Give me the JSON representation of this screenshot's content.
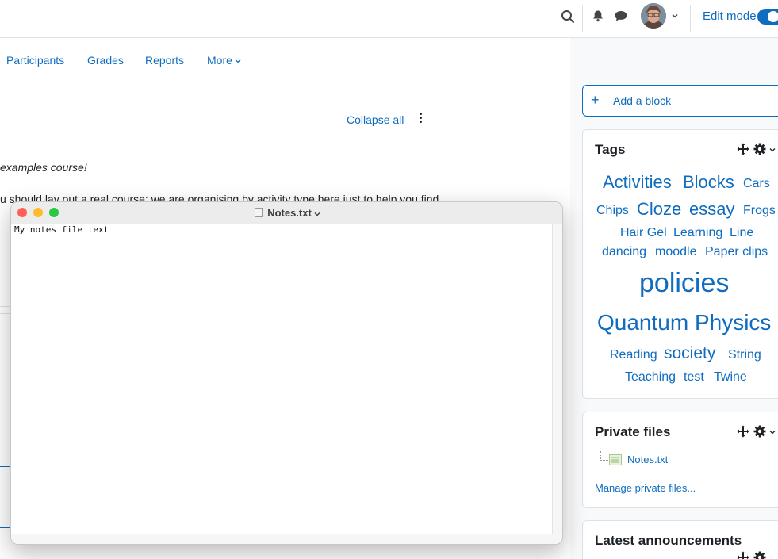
{
  "header": {
    "edit_mode_label": "Edit mode",
    "edit_mode_on": true,
    "icons": [
      "search-icon",
      "bell-icon",
      "chat-icon",
      "chevron-down-icon"
    ]
  },
  "secondary_nav": {
    "tabs": [
      {
        "label": "Participants"
      },
      {
        "label": "Grades"
      },
      {
        "label": "Reports"
      },
      {
        "label": "More"
      }
    ]
  },
  "course": {
    "collapse_all": "Collapse all",
    "welcome_fragment": "examples course!",
    "intro_fragment": "u should lay out a real course; we are organising by activity type here just to help you find"
  },
  "drawer": {
    "add_block_label": "Add a block",
    "tags": {
      "title": "Tags",
      "items": [
        {
          "label": "Activities"
        },
        {
          "label": "Blocks"
        },
        {
          "label": "Cars"
        },
        {
          "label": "Chips"
        },
        {
          "label": "Cloze"
        },
        {
          "label": "essay"
        },
        {
          "label": "Frogs"
        },
        {
          "label": "Hair Gel"
        },
        {
          "label": "Learning"
        },
        {
          "label": "Line dancing"
        },
        {
          "label": "moodle"
        },
        {
          "label": "Paper clips"
        },
        {
          "label": "policies"
        },
        {
          "label": "Quantum Physics"
        },
        {
          "label": "Reading"
        },
        {
          "label": "society"
        },
        {
          "label": "String"
        },
        {
          "label": "Teaching"
        },
        {
          "label": "test"
        },
        {
          "label": "Twine"
        }
      ]
    },
    "private_files": {
      "title": "Private files",
      "file_name": "Notes.txt",
      "manage_link": "Manage private files..."
    },
    "latest_announcements": {
      "title": "Latest announcements"
    }
  },
  "editor_window": {
    "title": "Notes.txt",
    "content": "My notes file text",
    "traffic_lights": {
      "close": "#ff5f57",
      "minimize": "#febc2e",
      "zoom": "#28c840"
    }
  },
  "colors": {
    "accent": "#0f6cbf",
    "text": "#1d2125",
    "border": "#dee2e6",
    "drawer_bg": "#f8f9fa"
  }
}
